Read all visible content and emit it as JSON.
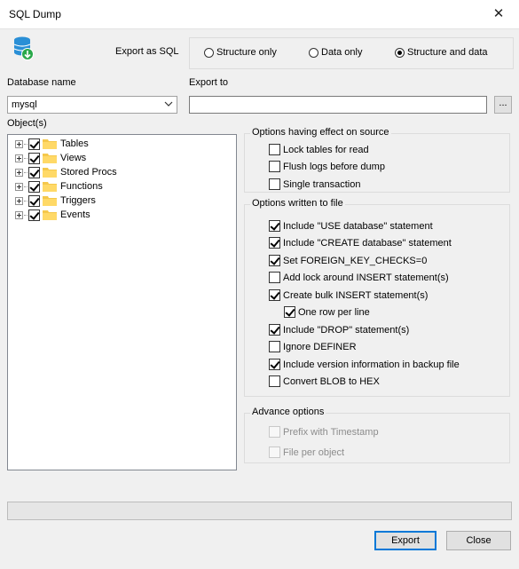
{
  "window": {
    "title": "SQL Dump",
    "close_glyph": "✕"
  },
  "export_as": {
    "label": "Export as SQL",
    "options": [
      {
        "label": "Structure only",
        "selected": false
      },
      {
        "label": "Data only",
        "selected": false
      },
      {
        "label": "Structure and data",
        "selected": true
      }
    ]
  },
  "database": {
    "label": "Database name",
    "value": "mysql"
  },
  "export_to": {
    "label": "Export to",
    "value": "",
    "browse_label": "..."
  },
  "objects": {
    "label": "Object(s)",
    "items": [
      {
        "label": "Tables",
        "checked": true
      },
      {
        "label": "Views",
        "checked": true
      },
      {
        "label": "Stored Procs",
        "checked": true
      },
      {
        "label": "Functions",
        "checked": true
      },
      {
        "label": "Triggers",
        "checked": true
      },
      {
        "label": "Events",
        "checked": true
      }
    ]
  },
  "source_options": {
    "title": "Options having effect on source",
    "items": [
      {
        "label": "Lock tables for read",
        "checked": false
      },
      {
        "label": "Flush logs before dump",
        "checked": false
      },
      {
        "label": "Single transaction",
        "checked": false
      }
    ]
  },
  "file_options": {
    "title": "Options written to file",
    "items": [
      {
        "label": "Include \"USE database\" statement",
        "checked": true
      },
      {
        "label": "Include \"CREATE database\" statement",
        "checked": true
      },
      {
        "label": "Set FOREIGN_KEY_CHECKS=0",
        "checked": true
      },
      {
        "label": "Add lock around INSERT statement(s)",
        "checked": false
      },
      {
        "label": "Create bulk INSERT statement(s)",
        "checked": true
      },
      {
        "label": "One row per line",
        "checked": true
      },
      {
        "label": "Include \"DROP\" statement(s)",
        "checked": true
      },
      {
        "label": "Ignore DEFINER",
        "checked": false
      },
      {
        "label": "Include version information in backup file",
        "checked": true
      },
      {
        "label": "Convert BLOB to HEX",
        "checked": false
      }
    ]
  },
  "advance_options": {
    "title": "Advance options",
    "items": [
      {
        "label": "Prefix with Timestamp",
        "checked": false,
        "enabled": false
      },
      {
        "label": "File per object",
        "checked": false,
        "enabled": false
      }
    ]
  },
  "buttons": {
    "export": "Export",
    "close": "Close"
  },
  "colors": {
    "accent": "#0078d7",
    "folder": "#f5c84c",
    "db_icon": "#2a8fd6",
    "db_badge": "#29a84a"
  }
}
